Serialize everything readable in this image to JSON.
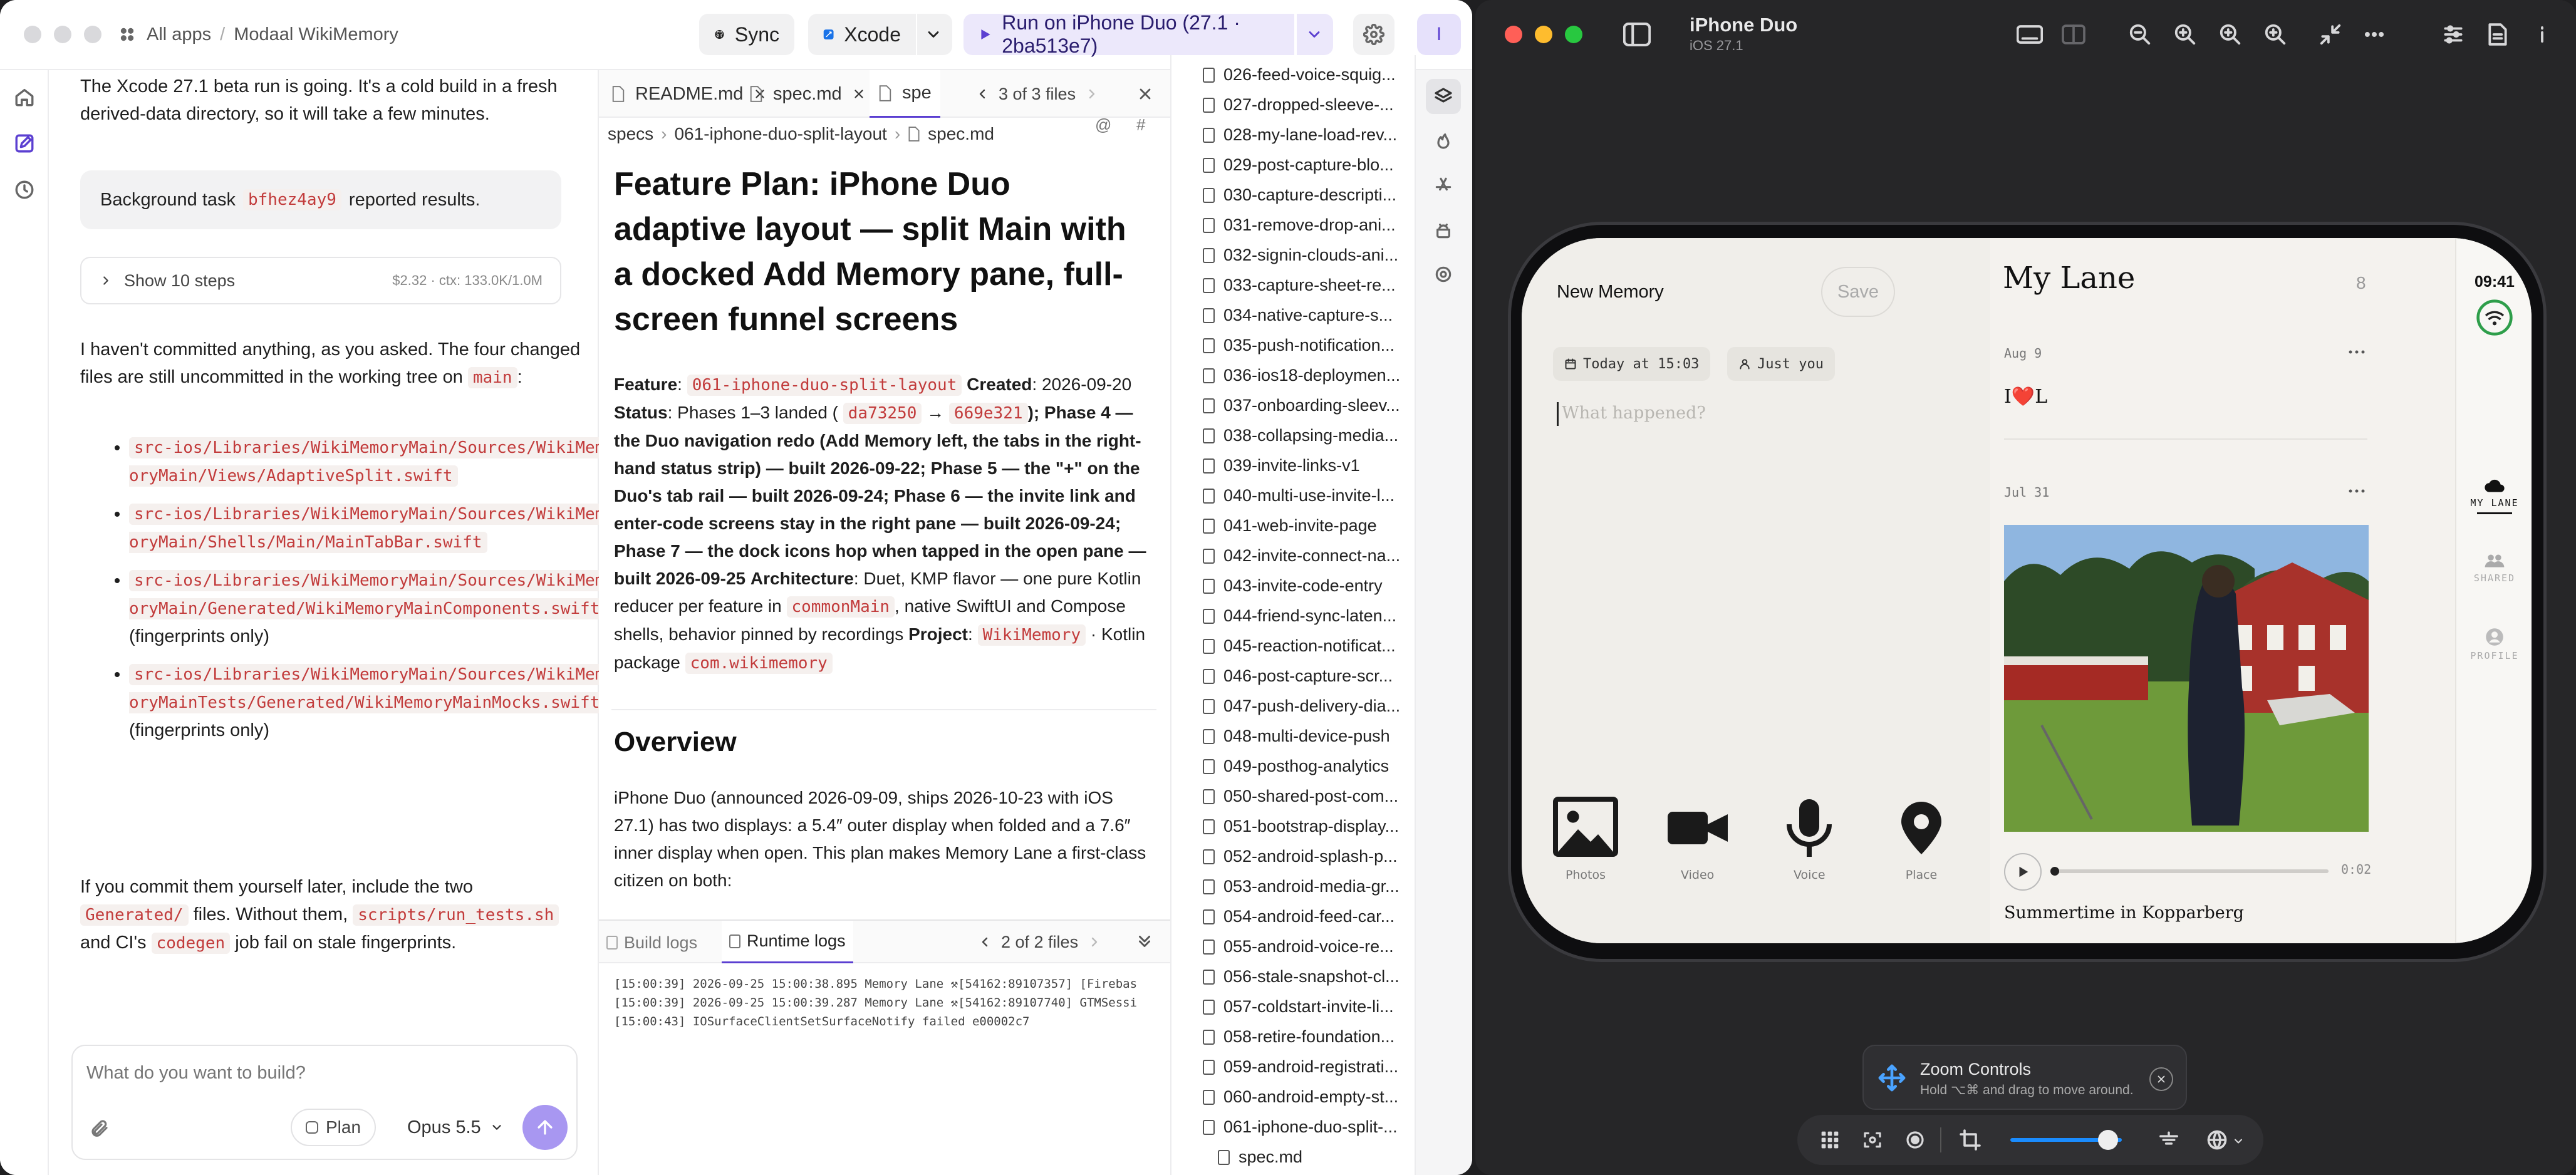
{
  "left": {
    "breadcrumb_all": "All apps",
    "breadcrumb_sep": "/",
    "project": "Modaal WikiMemory",
    "sync_label": "Sync",
    "xcode_label": "Xcode",
    "run_label": "Run on iPhone Duo (27.1 · 2ba513e7)",
    "avatar_initial": "I",
    "chat": {
      "intro": "The Xcode 27.1 beta run is going. It's a cold build in a fresh derived-data directory, so it will take a few minutes.",
      "bg_prefix": "Background task",
      "bg_task": "bfhez4ay9",
      "bg_suffix": "reported results.",
      "steps_label": "Show 10 steps",
      "steps_meta": "$2.32 · ctx: 133.0K/1.0M",
      "commit_text": "I haven't committed anything, as you asked. The four changed files are still uncommitted in the working tree on",
      "branch": "main",
      "colon": ":",
      "files": [
        {
          "path": "src-ios/Libraries/WikiMemoryMain/Sources/WikiMemoryMain/Views/AdaptiveSplit.swift",
          "note": ""
        },
        {
          "path": "src-ios/Libraries/WikiMemoryMain/Sources/WikiMemoryMain/Shells/Main/MainTabBar.swift",
          "note": ""
        },
        {
          "path": "src-ios/Libraries/WikiMemoryMain/Sources/WikiMemoryMain/Generated/WikiMemoryMainComponents.swift",
          "note": "(fingerprints only)"
        },
        {
          "path": "src-ios/Libraries/WikiMemoryMain/Sources/WikiMemoryMainTests/Generated/WikiMemoryMainMocks.swift",
          "note": "(fingerprints only)"
        }
      ],
      "outro_1": "If you commit them yourself later, include the two",
      "outro_generated": "Generated/",
      "outro_2": "files. Without them,",
      "outro_script": "scripts/run_tests.sh",
      "outro_3": "and CI's",
      "outro_codegen": "codegen",
      "outro_4": "job fail on stale fingerprints."
    },
    "composer": {
      "placeholder": "What do you want to build?",
      "plan_label": "Plan",
      "model_label": "Opus 5.5"
    },
    "editor": {
      "tabs": [
        "README.md",
        "spec.md",
        "spe"
      ],
      "files_nav": "3 of 3 files",
      "crumb_specs": "specs",
      "crumb_folder": "061-iphone-duo-split-layout",
      "crumb_file": "spec.md",
      "title": "Feature Plan: iPhone Duo adaptive layout — split Main with a docked Add Memory pane, full-screen funnel screens",
      "feature_label": "Feature",
      "feature_slug": "061-iphone-duo-split-layout",
      "created_label": "Created",
      "created_date": "2026-09-20",
      "status_label": "Status",
      "status_text": "Phases 1–3 landed (",
      "commit_a": "da73250",
      "arrow": "→",
      "commit_b": "669e321",
      "phases_text": "); Phase 4 — the Duo navigation redo (Add Memory left, the tabs in the right-hand status strip) — built 2026-09-22; Phase 5 — the \"+\" on the Duo's tab rail — built 2026-09-24; Phase 6 — the invite link and enter-code screens stay in the right pane — built 2026-09-24; Phase 7 — the dock icons hop when tapped in the open pane — built 2026-09-25",
      "arch_label": "Architecture",
      "arch_text": "Duet, KMP flavor — one pure Kotlin reducer per feature in",
      "arch_chip": "commonMain",
      "arch_text2": ", native SwiftUI and Compose shells, behavior pinned by recordings",
      "project_label": "Project",
      "project_chip": "WikiMemory",
      "pkg_text": "· Kotlin package",
      "pkg_chip": "com.wikimemory",
      "overview_heading": "Overview",
      "overview_text": "iPhone Duo (announced 2026-09-09, ships 2026-10-23 with iOS 27.1) has two displays: a 5.4″ outer display when folded and a 7.6″ inner display when open. This plan makes Memory Lane a first-class citizen on both:"
    },
    "logs": {
      "tab_build": "Build logs",
      "tab_runtime": "Runtime logs",
      "files_nav": "2 of 2 files",
      "lines": [
        "[15:00:39] 2026-09-25 15:00:38.895 Memory Lane ⚒[54162:89107357] [Firebas",
        "[15:00:39] 2026-09-25 15:00:39.287 Memory Lane ⚒[54162:89107740] GTMSessi",
        "[15:00:43] IOSurfaceClientSetSurfaceNotify failed e00002c7"
      ]
    },
    "file_list": [
      "026-feed-voice-squig...",
      "027-dropped-sleeve-...",
      "028-my-lane-load-rev...",
      "029-post-capture-blo...",
      "030-capture-descripti...",
      "031-remove-drop-ani...",
      "032-signin-clouds-ani...",
      "033-capture-sheet-re...",
      "034-native-capture-s...",
      "035-push-notification...",
      "036-ios18-deploymen...",
      "037-onboarding-sleev...",
      "038-collapsing-media...",
      "039-invite-links-v1",
      "040-multi-use-invite-l...",
      "041-web-invite-page",
      "042-invite-connect-na...",
      "043-invite-code-entry",
      "044-friend-sync-laten...",
      "045-reaction-notificat...",
      "046-post-capture-scr...",
      "047-push-delivery-dia...",
      "048-multi-device-push",
      "049-posthog-analytics",
      "050-shared-post-com...",
      "051-bootstrap-display...",
      "052-android-splash-p...",
      "053-android-media-gr...",
      "054-android-feed-car...",
      "055-android-voice-re...",
      "056-stale-snapshot-cl...",
      "057-coldstart-invite-li...",
      "058-retire-foundation...",
      "059-android-registrati...",
      "060-android-empty-st...",
      "061-iphone-duo-split-..."
    ],
    "file_child": "spec.md"
  },
  "right": {
    "device_name": "iPhone Duo",
    "os_version": "iOS 27.1",
    "app": {
      "new_memory": "New Memory",
      "save": "Save",
      "date_chip": "Today at 15:03",
      "audience_chip": "Just you",
      "what_placeholder": "What happened?",
      "media": [
        "Photos",
        "Video",
        "Voice",
        "Place"
      ],
      "lane_title": "My Lane",
      "lane_count": "8",
      "entry1_date": "Aug 9",
      "entry1_text_a": "I",
      "entry1_heart": "❤️",
      "entry1_text_b": "L",
      "entry2_date": "Jul 31",
      "audio_time": "0:02",
      "caption": "Summertime in Kopparberg",
      "clock": "09:41",
      "rail": [
        "MY LANE",
        "SHARED",
        "PROFILE"
      ]
    },
    "zoom": {
      "title": "Zoom Controls",
      "hint": "Hold ⌥⌘ and drag to move around.",
      "slider_level": 0.88
    }
  },
  "colors": {
    "accent": "#7B68EE",
    "run_purple": "#5b3fd1",
    "code_red": "#c23b3b"
  }
}
